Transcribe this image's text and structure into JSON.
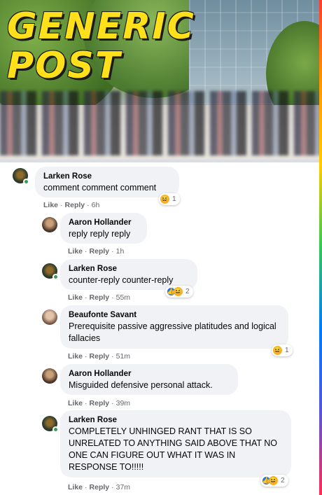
{
  "header": {
    "title_line1": "GENERIC",
    "title_line2": "POST"
  },
  "actions": {
    "like": "Like",
    "reply": "Reply",
    "separator": "·"
  },
  "reaction_icons": {
    "haha": "haha-emoji-icon",
    "like": "like-thumb-icon"
  },
  "comments": [
    {
      "author": "Larken Rose",
      "text": "comment comment comment",
      "time": "6h",
      "reaction_count": "1",
      "reaction_types": [
        "haha"
      ]
    },
    {
      "author": "Aaron Hollander",
      "text": "reply reply reply",
      "time": "1h"
    },
    {
      "author": "Larken Rose",
      "text": "counter-reply counter-reply",
      "time": "55m",
      "reaction_count": "2",
      "reaction_types": [
        "like",
        "haha"
      ]
    },
    {
      "author": "Beaufonte Savant",
      "text": "Prerequisite passive aggressive platitudes and logical fallacies",
      "time": "51m",
      "reaction_count": "1",
      "reaction_types": [
        "haha"
      ]
    },
    {
      "author": "Aaron Hollander",
      "text": "Misguided defensive personal attack.",
      "time": "39m"
    },
    {
      "author": "Larken Rose",
      "text": "COMPLETELY UNHINGED RANT THAT IS SO UNRELATED TO ANYTHING SAID ABOVE THAT NO ONE CAN FIGURE OUT WHAT IT WAS IN RESPONSE TO!!!!!",
      "time": "37m",
      "reaction_count": "2",
      "reaction_types": [
        "like",
        "haha"
      ]
    }
  ],
  "colors": {
    "title_yellow": "#ffe01a",
    "bubble_bg": "#f0f2f5",
    "meta_gray": "#65676b",
    "online_green": "#31a24c"
  }
}
